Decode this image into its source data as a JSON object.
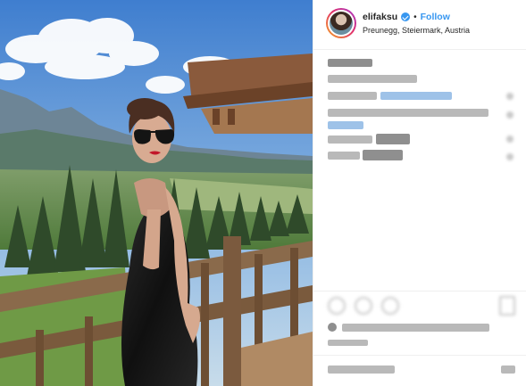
{
  "post": {
    "image_alt": "Woman in sunglasses on a wooden balcony above an alpine valley",
    "author": {
      "username": "elifaksu",
      "verified": true,
      "follow_label": "Follow",
      "separator": "•",
      "location": "Preunegg, Steiermark, Austria"
    }
  },
  "colors": {
    "accent": "#3897f0",
    "text": "#262626",
    "border": "#efefef"
  },
  "icons": {
    "verified": "verified-badge-icon",
    "like": "heart-icon",
    "comment": "comment-icon",
    "share": "share-icon",
    "save": "bookmark-icon"
  }
}
